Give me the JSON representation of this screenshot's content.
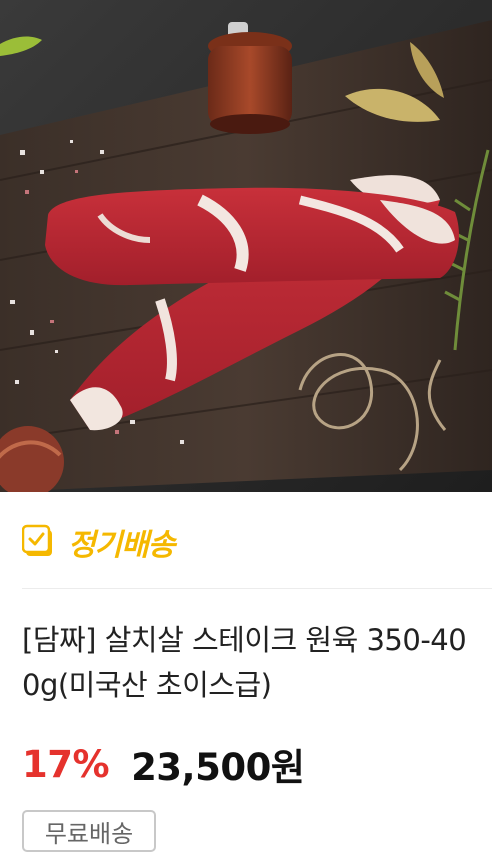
{
  "product": {
    "image_alt": "salchisal steak photo",
    "badge": {
      "icon": "calendar-check-icon",
      "label": "정기배송",
      "color": "#f5b800"
    },
    "title": "[담짜] 살치살 스테이크 원육 350-400g(미국산 초이스급)",
    "discount": "17%",
    "price": "23,500원",
    "shipping_tag": "무료배송",
    "colors": {
      "discount": "#e5322d",
      "price": "#111111",
      "title": "#222222"
    }
  }
}
